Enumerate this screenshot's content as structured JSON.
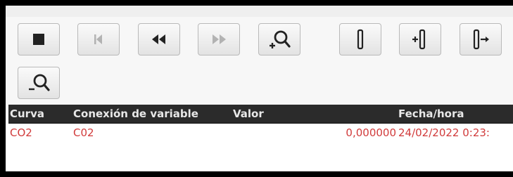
{
  "toolbar": {
    "row1": [
      {
        "name": "stop-button",
        "icon": "stop-icon",
        "enabled": true
      },
      {
        "name": "first-button",
        "icon": "skip-to-start-icon",
        "enabled": false
      },
      {
        "name": "rewind-button",
        "icon": "rewind-icon",
        "enabled": true
      },
      {
        "name": "forward-button",
        "icon": "fast-forward-icon",
        "enabled": false
      },
      {
        "name": "zoom-in-button",
        "icon": "zoom-in-icon",
        "enabled": true
      },
      {
        "name": "ruler-button",
        "icon": "ruler-icon",
        "enabled": true
      },
      {
        "name": "ruler-left-button",
        "icon": "ruler-move-left-icon",
        "enabled": true
      },
      {
        "name": "ruler-right-button",
        "icon": "ruler-move-right-icon",
        "enabled": true
      }
    ],
    "row2": [
      {
        "name": "zoom-out-button",
        "icon": "zoom-out-icon",
        "enabled": true
      }
    ]
  },
  "table": {
    "headers": {
      "curva": "Curva",
      "conexion": "Conexión de variable",
      "valor": "Valor",
      "fecha": "Fecha/hora"
    },
    "rows": [
      {
        "curva": "CO2",
        "conexion": "C02",
        "valor": "0,000000",
        "fecha": "24/02/2022 0:23:"
      }
    ]
  },
  "colors": {
    "header_bg": "#2b2b2b",
    "row_text": "#d13b3b"
  }
}
